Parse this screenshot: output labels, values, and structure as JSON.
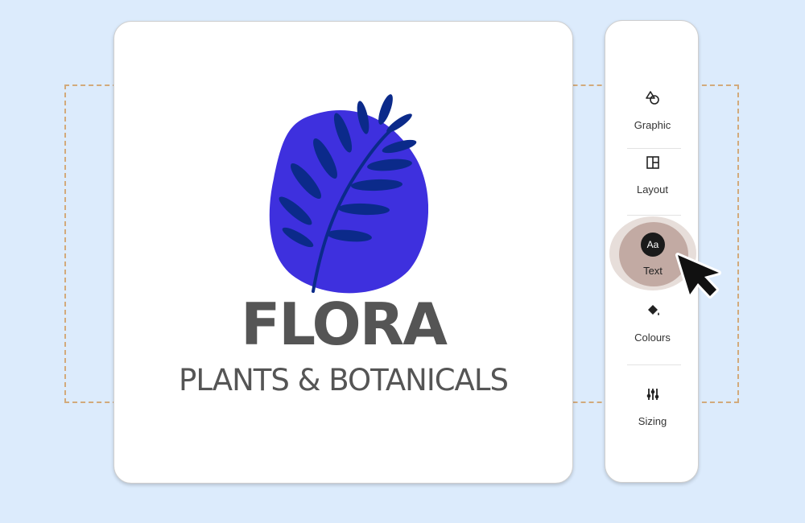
{
  "logo": {
    "name": "FLORA",
    "tagline": "PLANTS & BOTANICALS",
    "blob_color": "#3e30de",
    "leaf_color": "#0b2a8a",
    "text_color": "#555555"
  },
  "toolbar": {
    "items": [
      {
        "label": "Graphic",
        "icon": "shapes-icon"
      },
      {
        "label": "Layout",
        "icon": "layout-grid-icon"
      },
      {
        "label": "Text",
        "icon": "text-aa-icon",
        "icon_text": "Aa",
        "active": true
      },
      {
        "label": "Colours",
        "icon": "paint-bucket-icon"
      },
      {
        "label": "Sizing",
        "icon": "sliders-icon"
      }
    ]
  },
  "colors": {
    "background": "#dcebfc",
    "dashed_border": "#d2aa7c",
    "active_highlight": "#c2aaa3"
  }
}
